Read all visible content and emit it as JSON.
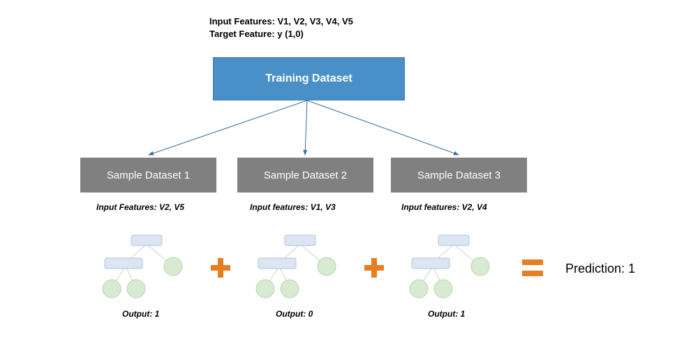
{
  "header": {
    "line1": "Input Features: V1, V2, V3, V4, V5",
    "line2": "Target Feature: y (1,0)"
  },
  "training_box": {
    "label": "Training Dataset"
  },
  "samples": [
    {
      "label": "Sample Dataset 1",
      "features": "Input Features: V2, V5",
      "output": "Output: 1"
    },
    {
      "label": "Sample Dataset 2",
      "features": "Input features: V1, V3",
      "output": "Output: 0"
    },
    {
      "label": "Sample Dataset 3",
      "features": "Input features: V2, V4",
      "output": "Output: 1"
    }
  ],
  "prediction": {
    "label": "Prediction: 1"
  },
  "colors": {
    "training_bg": "#4a90c8",
    "sample_bg": "#808080",
    "operator": "#e67e22",
    "tree_rect_fill": "#dce6f2",
    "tree_rect_stroke": "#b0c4de",
    "tree_circle_fill": "#d9ead3",
    "tree_circle_stroke": "#b6d7a8",
    "tree_line": "#d0d0d0"
  }
}
